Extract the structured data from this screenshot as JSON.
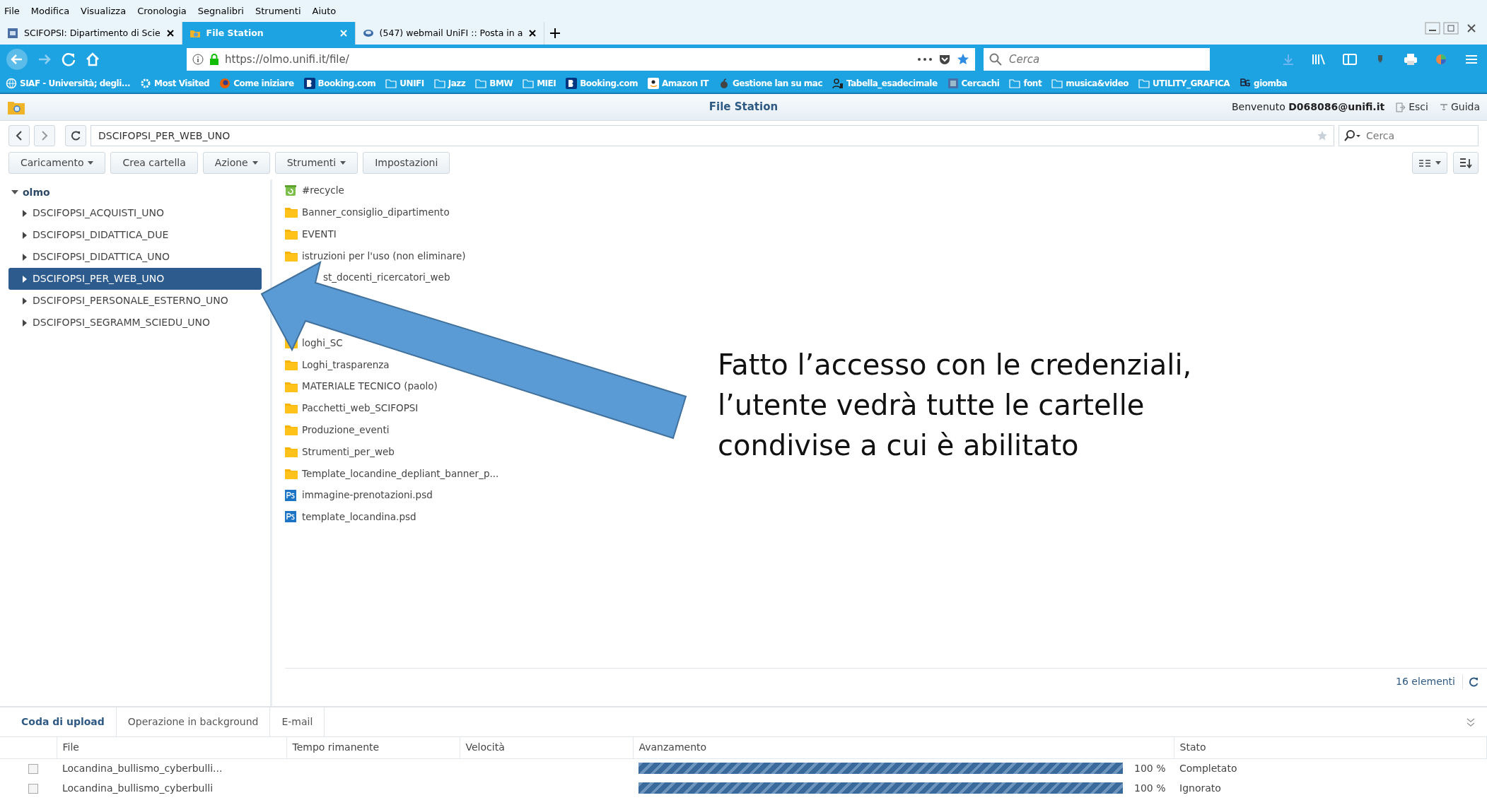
{
  "menu_bar": [
    "File",
    "Modifica",
    "Visualizza",
    "Cronologia",
    "Segnalibri",
    "Strumenti",
    "Aiuto"
  ],
  "browser_tabs": [
    {
      "title": "SCIFOPSI: Dipartimento di Scie",
      "selected": false,
      "kind": "site"
    },
    {
      "title": "File Station",
      "selected": true,
      "kind": "filestation"
    },
    {
      "title": "(547) webmail UniFI :: Posta in a",
      "selected": false,
      "kind": "mail"
    }
  ],
  "address_bar": {
    "url": "https://olmo.unifi.it/file/"
  },
  "browser_search": {
    "placeholder": "Cerca"
  },
  "bookmarks": [
    {
      "label": "SIAF - Università; degli...",
      "kind": "globe"
    },
    {
      "label": "Most Visited",
      "kind": "gear"
    },
    {
      "label": "Come iniziare",
      "kind": "firefox"
    },
    {
      "label": "Booking.com",
      "kind": "booking"
    },
    {
      "label": "UNIFI",
      "kind": "folder"
    },
    {
      "label": "Jazz",
      "kind": "folder"
    },
    {
      "label": "BMW",
      "kind": "folder"
    },
    {
      "label": "MIEI",
      "kind": "folder"
    },
    {
      "label": "Booking.com",
      "kind": "booking"
    },
    {
      "label": "Amazon IT",
      "kind": "amazon"
    },
    {
      "label": "Gestione lan su mac",
      "kind": "apple"
    },
    {
      "label": "Tabella_esadecimale",
      "kind": "hex"
    },
    {
      "label": "Cercachi",
      "kind": "site"
    },
    {
      "label": "font",
      "kind": "folder"
    },
    {
      "label": "musica&video",
      "kind": "folder"
    },
    {
      "label": "UTILITY_GRAFICA",
      "kind": "folder"
    },
    {
      "label": "giomba",
      "kind": "bg"
    }
  ],
  "app": {
    "title": "File Station",
    "welcome": "Benvenuto **D068086@unifi.it**",
    "logout": "Esci",
    "help": "Guida"
  },
  "path_field": {
    "value": "DSCIFOPSI_PER_WEB_UNO"
  },
  "search_field": {
    "placeholder": "Cerca"
  },
  "toolbar": [
    {
      "label": "Caricamento",
      "dropdown": true
    },
    {
      "label": "Crea cartella",
      "dropdown": false
    },
    {
      "label": "Azione",
      "dropdown": true
    },
    {
      "label": "Strumenti",
      "dropdown": true
    },
    {
      "label": "Impostazioni",
      "dropdown": false
    }
  ],
  "tree": {
    "label": "olmo",
    "expanded": true,
    "children": [
      {
        "label": "DSCIFOPSI_ACQUISTI_UNO",
        "selected": false
      },
      {
        "label": "DSCIFOPSI_DIDATTICA_DUE",
        "selected": false
      },
      {
        "label": "DSCIFOPSI_DIDATTICA_UNO",
        "selected": false
      },
      {
        "label": "DSCIFOPSI_PER_WEB_UNO",
        "selected": true
      },
      {
        "label": "DSCIFOPSI_PERSONALE_ESTERNO_UNO",
        "selected": false
      },
      {
        "label": "DSCIFOPSI_SEGRAMM_SCIEDU_UNO",
        "selected": false
      }
    ]
  },
  "files": [
    {
      "name": "#recycle",
      "kind": "recycle"
    },
    {
      "name": "Banner_consiglio_dipartimento",
      "kind": "folder"
    },
    {
      "name": "EVENTI",
      "kind": "folder"
    },
    {
      "name": "istruzioni per l'uso (non eliminare)",
      "kind": "folder"
    },
    {
      "name": "st_docenti_ricercatori_web",
      "kind": "covered"
    },
    {
      "kind": "blank"
    },
    {
      "kind": "blank"
    },
    {
      "name": "loghi_SC",
      "kind": "folder"
    },
    {
      "name": "Loghi_trasparenza",
      "kind": "folder"
    },
    {
      "name": "MATERIALE TECNICO (paolo)",
      "kind": "folder"
    },
    {
      "name": "Pacchetti_web_SCIFOPSI",
      "kind": "folder"
    },
    {
      "name": "Produzione_eventi",
      "kind": "folder"
    },
    {
      "name": "Strumenti_per_web",
      "kind": "folder"
    },
    {
      "name": "Template_locandine_depliant_banner_p...",
      "kind": "folder"
    },
    {
      "name": "immagine-prenotazioni.psd",
      "kind": "psd"
    },
    {
      "name": "template_locandina.psd",
      "kind": "psd"
    }
  ],
  "item_count": "16 elementi",
  "annotation": "Fatto l’accesso con le credenziali, l’utente vedrà tutte le cartelle condivise a cui è abilitato",
  "bottom_tabs": [
    {
      "label": "Coda di upload",
      "selected": true
    },
    {
      "label": "Operazione in background",
      "selected": false
    },
    {
      "label": "E-mail",
      "selected": false
    }
  ],
  "upload_table": {
    "columns": [
      "File",
      "Tempo rimanente",
      "Velocità",
      "Avanzamento",
      "Stato"
    ],
    "rows": [
      {
        "file": "Locandina_bullismo_cyberbulli...",
        "level": 1,
        "percent": "100 %",
        "status": "Completato"
      },
      {
        "file": "Locandina_bullismo_cyberbulli",
        "level": 1,
        "percent": "100 %",
        "status": "Ignorato"
      }
    ]
  }
}
